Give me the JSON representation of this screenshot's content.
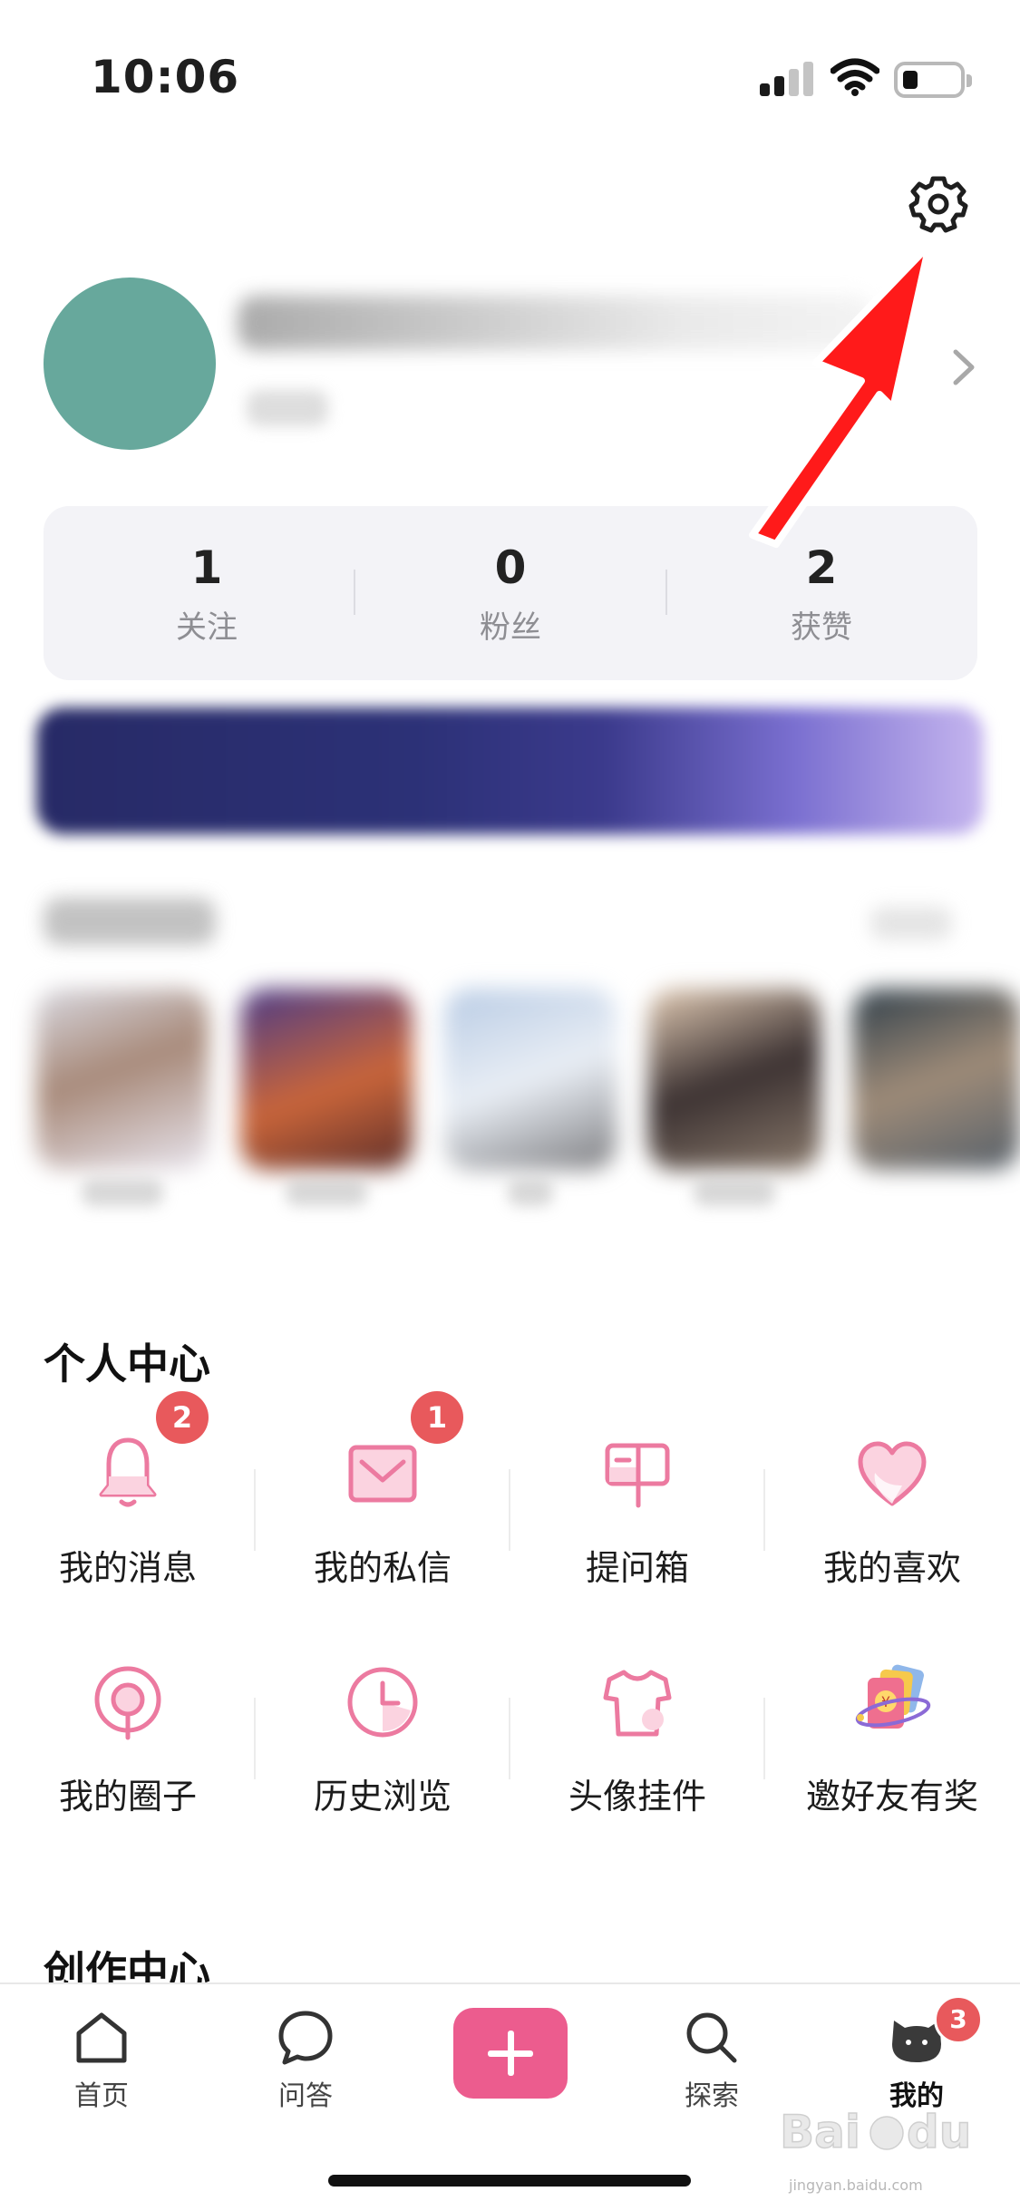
{
  "status_bar": {
    "time": "10:06"
  },
  "profile": {
    "stats": [
      {
        "value": "1",
        "label": "关注"
      },
      {
        "value": "0",
        "label": "粉丝"
      },
      {
        "value": "2",
        "label": "获赞"
      }
    ]
  },
  "personal_center": {
    "title": "个人中心",
    "items": [
      {
        "label": "我的消息",
        "icon": "bell-icon",
        "badge": "2"
      },
      {
        "label": "我的私信",
        "icon": "envelope-icon",
        "badge": "1"
      },
      {
        "label": "提问箱",
        "icon": "mailbox-icon"
      },
      {
        "label": "我的喜欢",
        "icon": "heart-icon"
      },
      {
        "label": "我的圈子",
        "icon": "circle-pin-icon"
      },
      {
        "label": "历史浏览",
        "icon": "clock-icon"
      },
      {
        "label": "头像挂件",
        "icon": "tshirt-icon"
      },
      {
        "label": "邀好友有奖",
        "icon": "red-envelope-icon"
      }
    ]
  },
  "creation_center": {
    "title": "创作中心"
  },
  "tab_bar": {
    "tabs": [
      {
        "label": "首页",
        "icon": "home-icon"
      },
      {
        "label": "问答",
        "icon": "chat-bubble-icon"
      },
      {
        "label": "",
        "icon": "plus-icon"
      },
      {
        "label": "探索",
        "icon": "search-icon"
      },
      {
        "label": "我的",
        "icon": "cat-avatar-icon",
        "badge": "3",
        "active": true
      }
    ]
  },
  "watermark": {
    "text": "jingyan.baidu.com"
  },
  "colors": {
    "accent_pink": "#ec5c8e",
    "icon_pink": "#ec7aa0",
    "badge_red": "#e8595c",
    "arrow_red": "#ff0000"
  }
}
